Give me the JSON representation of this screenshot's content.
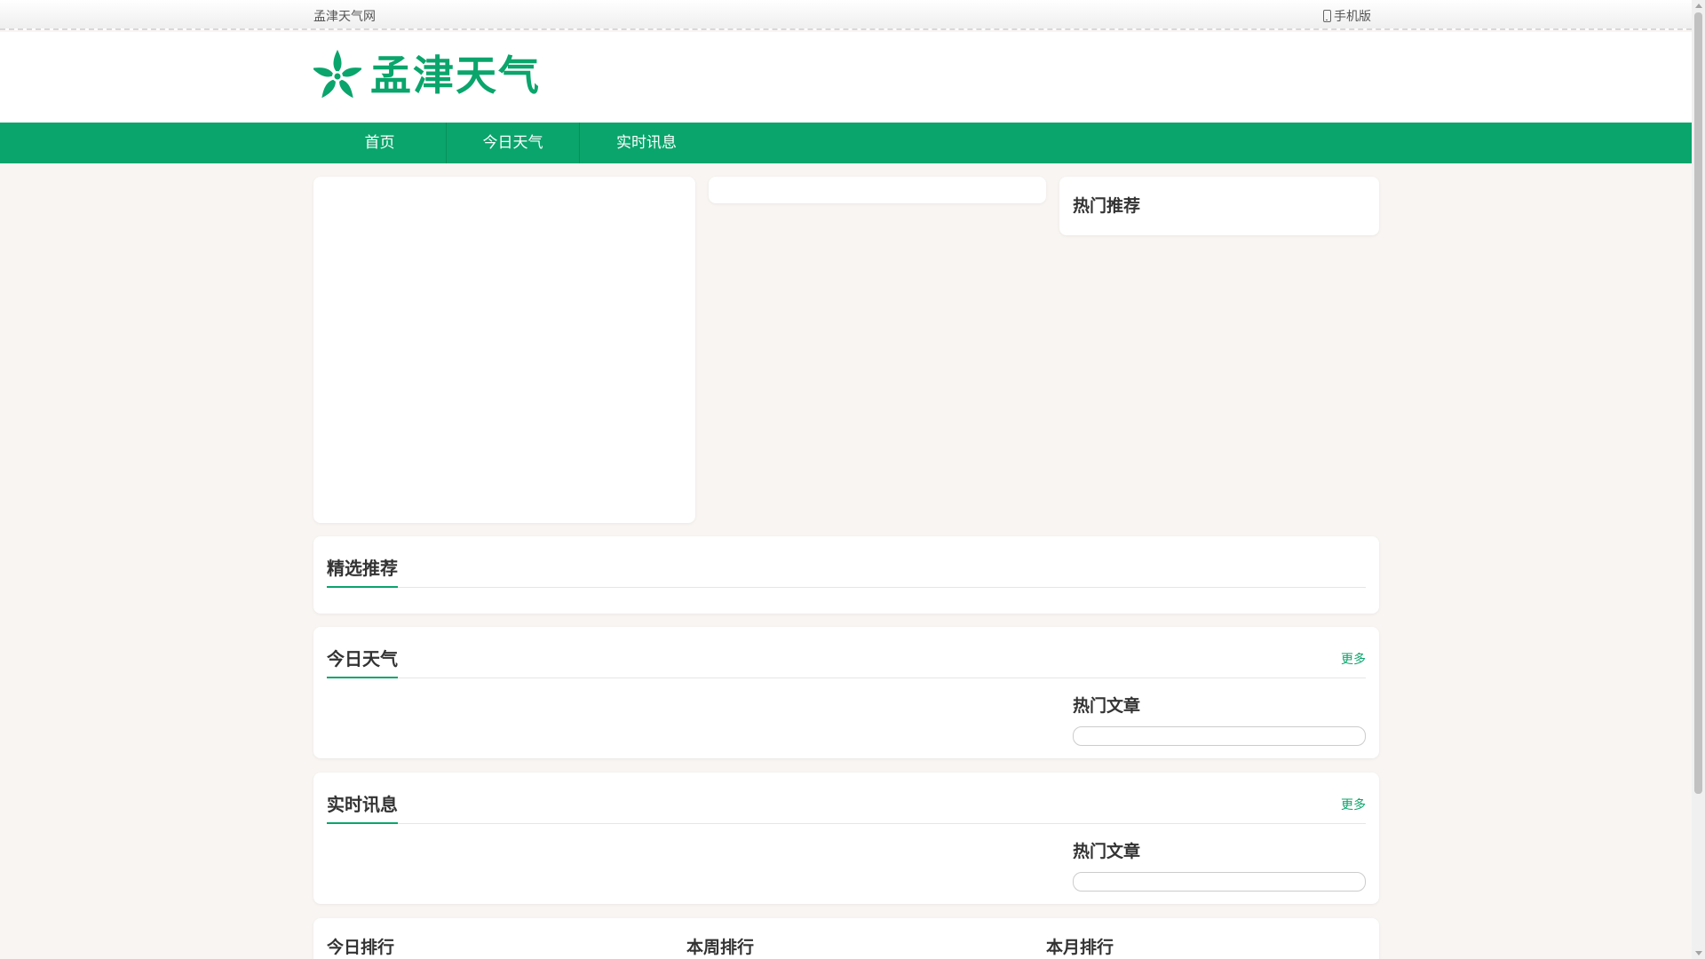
{
  "topbar": {
    "site_name": "孟津天气网",
    "mobile_label": "手机版",
    "mobile_icon": "phone-icon"
  },
  "header": {
    "logo_text": "孟津天气",
    "logo_icon": "star-flower-icon",
    "brand_color": "#0aa56c"
  },
  "nav": {
    "items": [
      {
        "label": "首页"
      },
      {
        "label": "今日天气"
      },
      {
        "label": "实时讯息"
      }
    ]
  },
  "side": {
    "hot_recommend_title": "热门推荐"
  },
  "featured": {
    "title": "精选推荐"
  },
  "today_weather": {
    "title": "今日天气",
    "more": "更多",
    "hot_title": "热门文章"
  },
  "realtime": {
    "title": "实时讯息",
    "more": "更多",
    "hot_title": "热门文章"
  },
  "rankings": {
    "today": "今日排行",
    "week": "本周排行",
    "month": "本月排行"
  }
}
